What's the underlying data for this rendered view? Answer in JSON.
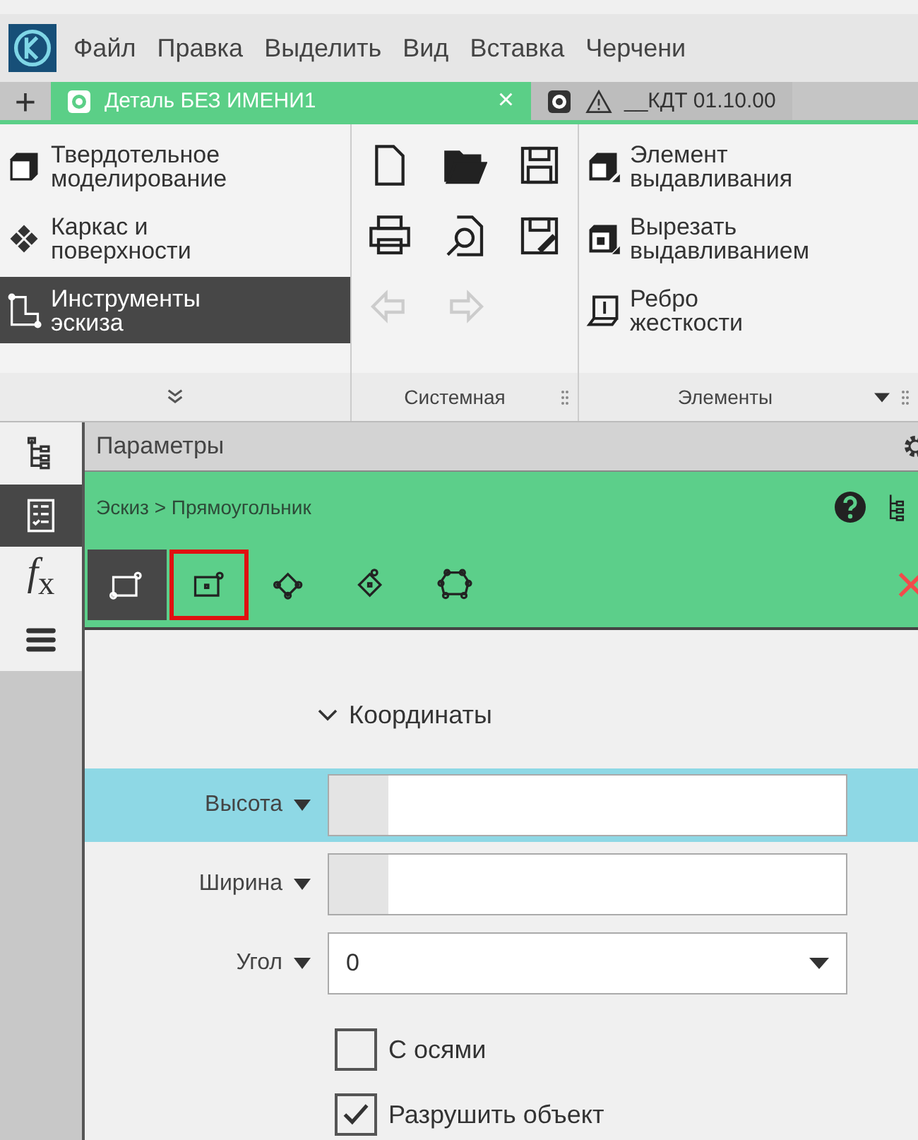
{
  "menu": {
    "items": [
      {
        "label": "Файл"
      },
      {
        "label": "Правка"
      },
      {
        "label": "Выделить"
      },
      {
        "label": "Вид"
      },
      {
        "label": "Вставка"
      },
      {
        "label": "Черчени"
      }
    ]
  },
  "tabs": [
    {
      "label": "Деталь БЕЗ ИМЕНИ1",
      "selected": true,
      "closable": true,
      "warning": false,
      "close": "×"
    },
    {
      "label": "__КДТ 01.10.00",
      "selected": false,
      "closable": false,
      "warning": true
    }
  ],
  "new_tab": "+",
  "ribbon": {
    "modes": [
      {
        "kind": "solid",
        "label": "Твердотельное моделирование",
        "selected": false
      },
      {
        "kind": "surface",
        "label": "Каркас и поверхности",
        "selected": false
      },
      {
        "kind": "sketch",
        "label": "Инструменты эскиза",
        "selected": true
      }
    ],
    "system": {
      "label": "Системная",
      "tools": [
        {
          "kind": "new",
          "disabled": false
        },
        {
          "kind": "open",
          "disabled": false
        },
        {
          "kind": "save",
          "disabled": false
        },
        {
          "kind": "print",
          "disabled": false
        },
        {
          "kind": "preview",
          "disabled": false
        },
        {
          "kind": "save-as",
          "disabled": false
        },
        {
          "kind": "undo",
          "disabled": true
        },
        {
          "kind": "redo",
          "disabled": true
        }
      ]
    },
    "elements": {
      "label": "Элементы",
      "items": [
        {
          "kind": "extrude",
          "label": "Элемент выдавливания"
        },
        {
          "kind": "cut",
          "label": "Вырезать выдавливанием"
        },
        {
          "kind": "rib",
          "label": "Ребро жесткости"
        }
      ]
    }
  },
  "sidebar": {
    "tabs": [
      {
        "kind": "tree",
        "selected": false
      },
      {
        "kind": "params",
        "selected": true
      },
      {
        "kind": "formula",
        "label": "*f*$_{x}$",
        "selected": false
      },
      {
        "kind": "layers",
        "selected": false
      }
    ]
  },
  "panel": {
    "title": "Параметры",
    "breadcrumb": "Эскиз > Прямоугольник",
    "modes": [
      {
        "kind": "rect",
        "selected": true,
        "highlighted": false
      },
      {
        "kind": "center-rect",
        "selected": false,
        "highlighted": true
      },
      {
        "kind": "tilted",
        "selected": false,
        "highlighted": false
      },
      {
        "kind": "tilted-center",
        "selected": false,
        "highlighted": false
      },
      {
        "kind": "rounded",
        "selected": false,
        "highlighted": false
      }
    ],
    "section": {
      "title": "Координаты",
      "expanded": true
    },
    "fields": [
      {
        "kind": "spin",
        "label": "Высота",
        "selected": true
      },
      {
        "kind": "spin",
        "label": "Ширина",
        "selected": false
      },
      {
        "kind": "select",
        "label": "Угол",
        "value": "0",
        "selected": false
      }
    ],
    "checkboxes": [
      {
        "label": "С осями",
        "checked": false
      },
      {
        "label": "Разрушить объект",
        "checked": true
      }
    ]
  }
}
